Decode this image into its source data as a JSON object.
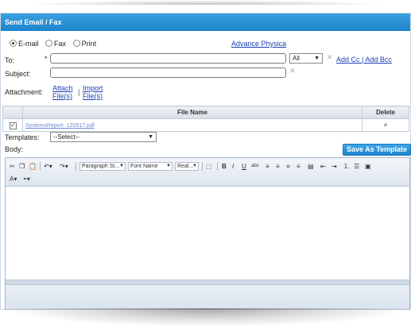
{
  "dialog": {
    "title": "Send Email / Fax"
  },
  "mode": {
    "options": [
      {
        "label": "E-mail",
        "selected": true
      },
      {
        "label": "Fax",
        "selected": false
      },
      {
        "label": "Print",
        "selected": false
      }
    ],
    "advance_link": "Advance Physica"
  },
  "form": {
    "to_label": "To:",
    "required_mark": "*",
    "to_value": "",
    "recipient_select": "All",
    "add_cc_bcc": "Add Cc | Add Bcc",
    "subject_label": "Subject:",
    "subject_value": "",
    "attachment_label": "Attachment:",
    "attach_link": "Attach File(s)",
    "attach_separator": "|",
    "import_link": "Import File(s)"
  },
  "attachments": {
    "headers": [
      "File Name",
      "Delete"
    ],
    "rows": [
      {
        "checked": true,
        "file_name": "SystemsReport_120917.pdf",
        "delete": "×"
      }
    ]
  },
  "templates": {
    "label": "Templates:",
    "selected": "--Select--"
  },
  "body": {
    "label": "Body:",
    "save_template": "Save As Template"
  },
  "editor": {
    "paragraph_style": "Paragraph St...",
    "font_name": "Font Name",
    "font_size": "Real..."
  }
}
